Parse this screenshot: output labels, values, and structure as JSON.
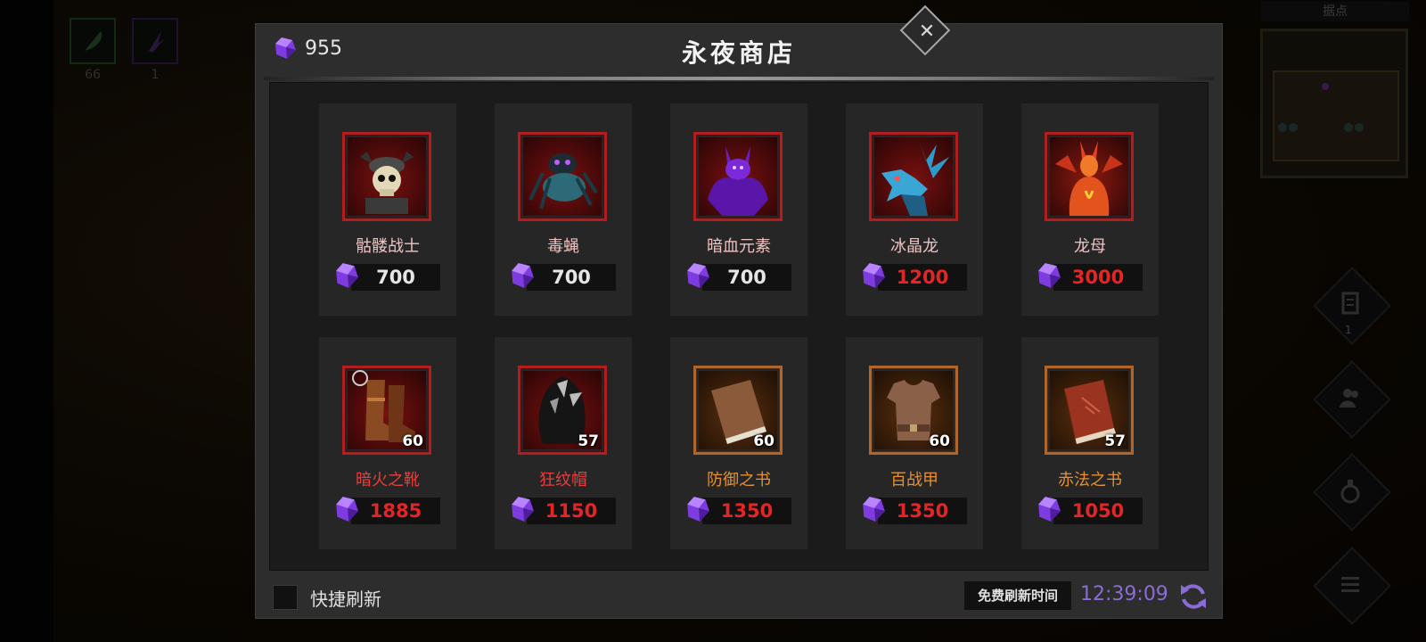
{
  "background": {
    "inventory": [
      {
        "icon": "feather-icon",
        "count": "66"
      },
      {
        "icon": "claw-icon",
        "count": "1"
      }
    ],
    "minimap_title": "据点",
    "side_buttons": [
      {
        "icon": "scroll-icon",
        "badge": "1"
      },
      {
        "icon": "party-icon"
      },
      {
        "icon": "potion-icon"
      },
      {
        "icon": "list-icon"
      }
    ]
  },
  "shop": {
    "title": "永夜商店",
    "currency": "955",
    "currency_icon": "purple-gem-icon",
    "close_icon": "close-icon",
    "items": [
      {
        "name": "骷髅战士",
        "price": "700",
        "name_color": "pink",
        "price_color": "white",
        "frame": "red",
        "level": "",
        "icon": "skeleton-warrior-icon"
      },
      {
        "name": "毒蝇",
        "price": "700",
        "name_color": "pink",
        "price_color": "white",
        "frame": "red",
        "level": "",
        "icon": "poison-fly-icon"
      },
      {
        "name": "暗血元素",
        "price": "700",
        "name_color": "pink",
        "price_color": "white",
        "frame": "red",
        "level": "",
        "icon": "dark-blood-elemental-icon"
      },
      {
        "name": "冰晶龙",
        "price": "1200",
        "name_color": "pink",
        "price_color": "red",
        "frame": "red",
        "level": "",
        "icon": "ice-crystal-dragon-icon"
      },
      {
        "name": "龙母",
        "price": "3000",
        "name_color": "pink",
        "price_color": "red",
        "frame": "red",
        "level": "",
        "icon": "dragon-mother-icon"
      },
      {
        "name": "暗火之靴",
        "price": "1885",
        "name_color": "red",
        "price_color": "red",
        "frame": "red",
        "level": "60",
        "icon": "boots-icon"
      },
      {
        "name": "狂纹帽",
        "price": "1150",
        "name_color": "red",
        "price_color": "red",
        "frame": "red",
        "level": "57",
        "icon": "hood-icon"
      },
      {
        "name": "防御之书",
        "price": "1350",
        "name_color": "orange",
        "price_color": "red",
        "frame": "brown",
        "level": "60",
        "icon": "book-icon"
      },
      {
        "name": "百战甲",
        "price": "1350",
        "name_color": "orange",
        "price_color": "red",
        "frame": "brown",
        "level": "60",
        "icon": "armor-icon"
      },
      {
        "name": "赤法之书",
        "price": "1050",
        "name_color": "orange",
        "price_color": "red",
        "frame": "brown",
        "level": "57",
        "icon": "red-book-icon"
      }
    ],
    "quick_refresh_label": "快捷刷新",
    "free_refresh_label": "免费刷新时间",
    "timer": "12:39:09",
    "refresh_icon": "refresh-icon"
  },
  "colors": {
    "price_red": "#e32525",
    "name_red": "#ec3c3c",
    "name_orange": "#e7902f",
    "timer_purple": "#8a6cd6",
    "frame_red": "#b21d1d",
    "frame_brown": "#b0662a"
  }
}
